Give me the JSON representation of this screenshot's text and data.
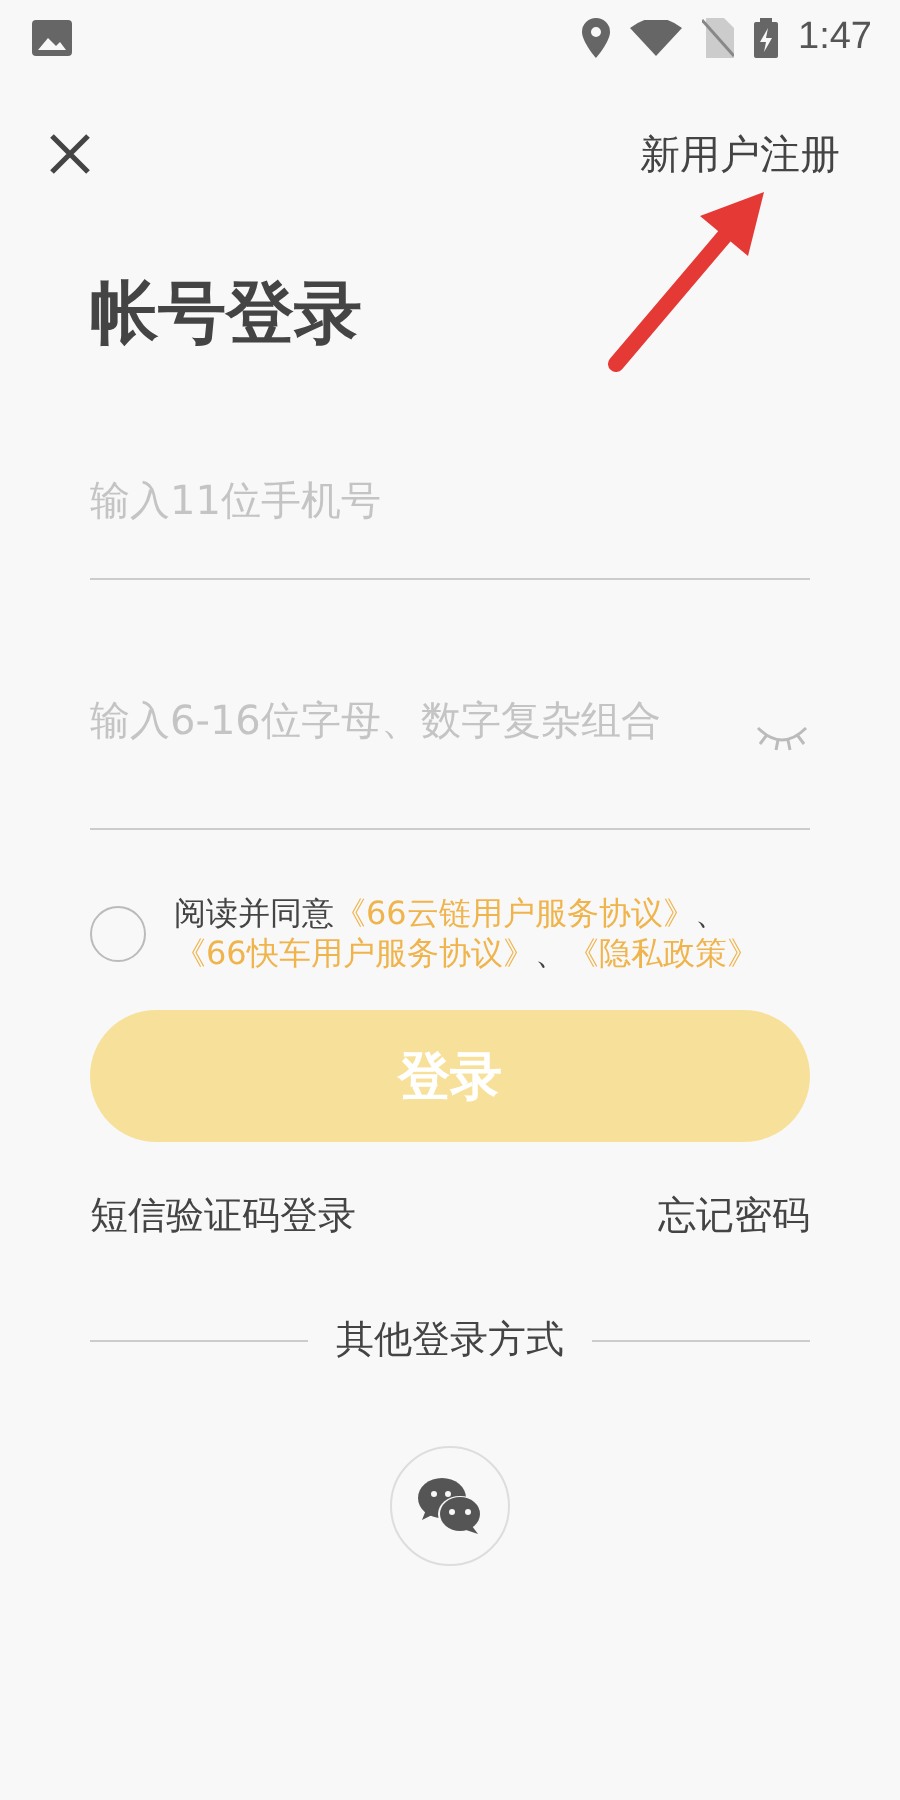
{
  "status_bar": {
    "time": "1:47"
  },
  "top_bar": {
    "register_link": "新用户注册"
  },
  "title": "帐号登录",
  "phone_field": {
    "placeholder": "输入11位手机号"
  },
  "password_field": {
    "placeholder": "输入6-16位字母、数字复杂组合"
  },
  "agreement": {
    "checked": false,
    "parts": [
      {
        "kind": "text",
        "text": "阅读并同意"
      },
      {
        "kind": "link",
        "text": "《66云链用户服务协议》"
      },
      {
        "kind": "text",
        "text": "、"
      },
      {
        "kind": "link",
        "text": "《66快车用户服务协议》"
      },
      {
        "kind": "text",
        "text": "、"
      },
      {
        "kind": "link",
        "text": "《隐私政策》"
      }
    ]
  },
  "login_button": {
    "label": "登录",
    "disabled": true
  },
  "links": {
    "sms_login": "短信验证码登录",
    "forgot_password": "忘记密码"
  },
  "other_login": {
    "label": "其他登录方式"
  }
}
